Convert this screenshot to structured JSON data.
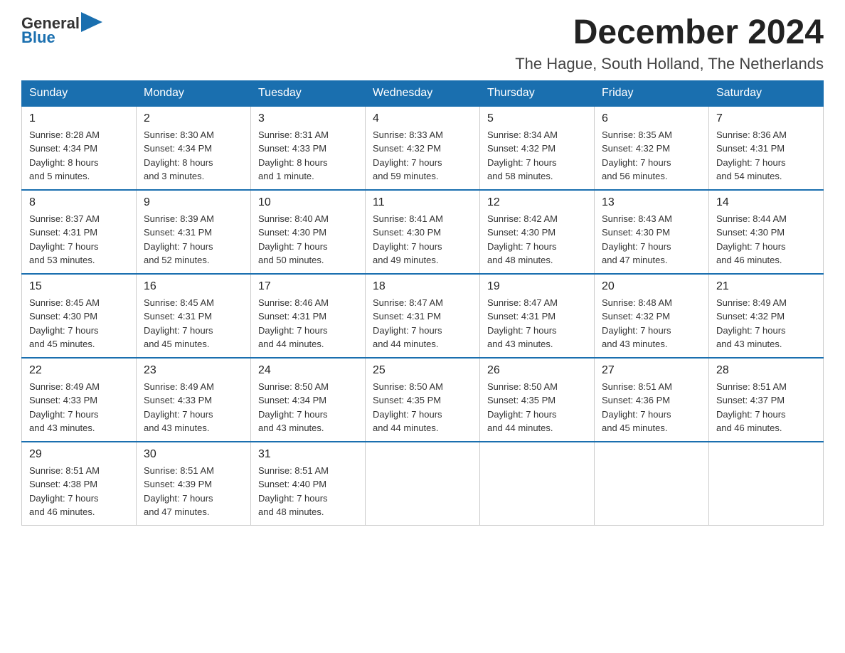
{
  "logo": {
    "text_general": "General",
    "text_blue": "Blue"
  },
  "header": {
    "month_year": "December 2024",
    "location": "The Hague, South Holland, The Netherlands"
  },
  "weekdays": [
    "Sunday",
    "Monday",
    "Tuesday",
    "Wednesday",
    "Thursday",
    "Friday",
    "Saturday"
  ],
  "weeks": [
    [
      {
        "day": "1",
        "sunrise": "8:28 AM",
        "sunset": "4:34 PM",
        "daylight": "8 hours and 5 minutes."
      },
      {
        "day": "2",
        "sunrise": "8:30 AM",
        "sunset": "4:34 PM",
        "daylight": "8 hours and 3 minutes."
      },
      {
        "day": "3",
        "sunrise": "8:31 AM",
        "sunset": "4:33 PM",
        "daylight": "8 hours and 1 minute."
      },
      {
        "day": "4",
        "sunrise": "8:33 AM",
        "sunset": "4:32 PM",
        "daylight": "7 hours and 59 minutes."
      },
      {
        "day": "5",
        "sunrise": "8:34 AM",
        "sunset": "4:32 PM",
        "daylight": "7 hours and 58 minutes."
      },
      {
        "day": "6",
        "sunrise": "8:35 AM",
        "sunset": "4:32 PM",
        "daylight": "7 hours and 56 minutes."
      },
      {
        "day": "7",
        "sunrise": "8:36 AM",
        "sunset": "4:31 PM",
        "daylight": "7 hours and 54 minutes."
      }
    ],
    [
      {
        "day": "8",
        "sunrise": "8:37 AM",
        "sunset": "4:31 PM",
        "daylight": "7 hours and 53 minutes."
      },
      {
        "day": "9",
        "sunrise": "8:39 AM",
        "sunset": "4:31 PM",
        "daylight": "7 hours and 52 minutes."
      },
      {
        "day": "10",
        "sunrise": "8:40 AM",
        "sunset": "4:30 PM",
        "daylight": "7 hours and 50 minutes."
      },
      {
        "day": "11",
        "sunrise": "8:41 AM",
        "sunset": "4:30 PM",
        "daylight": "7 hours and 49 minutes."
      },
      {
        "day": "12",
        "sunrise": "8:42 AM",
        "sunset": "4:30 PM",
        "daylight": "7 hours and 48 minutes."
      },
      {
        "day": "13",
        "sunrise": "8:43 AM",
        "sunset": "4:30 PM",
        "daylight": "7 hours and 47 minutes."
      },
      {
        "day": "14",
        "sunrise": "8:44 AM",
        "sunset": "4:30 PM",
        "daylight": "7 hours and 46 minutes."
      }
    ],
    [
      {
        "day": "15",
        "sunrise": "8:45 AM",
        "sunset": "4:30 PM",
        "daylight": "7 hours and 45 minutes."
      },
      {
        "day": "16",
        "sunrise": "8:45 AM",
        "sunset": "4:31 PM",
        "daylight": "7 hours and 45 minutes."
      },
      {
        "day": "17",
        "sunrise": "8:46 AM",
        "sunset": "4:31 PM",
        "daylight": "7 hours and 44 minutes."
      },
      {
        "day": "18",
        "sunrise": "8:47 AM",
        "sunset": "4:31 PM",
        "daylight": "7 hours and 44 minutes."
      },
      {
        "day": "19",
        "sunrise": "8:47 AM",
        "sunset": "4:31 PM",
        "daylight": "7 hours and 43 minutes."
      },
      {
        "day": "20",
        "sunrise": "8:48 AM",
        "sunset": "4:32 PM",
        "daylight": "7 hours and 43 minutes."
      },
      {
        "day": "21",
        "sunrise": "8:49 AM",
        "sunset": "4:32 PM",
        "daylight": "7 hours and 43 minutes."
      }
    ],
    [
      {
        "day": "22",
        "sunrise": "8:49 AM",
        "sunset": "4:33 PM",
        "daylight": "7 hours and 43 minutes."
      },
      {
        "day": "23",
        "sunrise": "8:49 AM",
        "sunset": "4:33 PM",
        "daylight": "7 hours and 43 minutes."
      },
      {
        "day": "24",
        "sunrise": "8:50 AM",
        "sunset": "4:34 PM",
        "daylight": "7 hours and 43 minutes."
      },
      {
        "day": "25",
        "sunrise": "8:50 AM",
        "sunset": "4:35 PM",
        "daylight": "7 hours and 44 minutes."
      },
      {
        "day": "26",
        "sunrise": "8:50 AM",
        "sunset": "4:35 PM",
        "daylight": "7 hours and 44 minutes."
      },
      {
        "day": "27",
        "sunrise": "8:51 AM",
        "sunset": "4:36 PM",
        "daylight": "7 hours and 45 minutes."
      },
      {
        "day": "28",
        "sunrise": "8:51 AM",
        "sunset": "4:37 PM",
        "daylight": "7 hours and 46 minutes."
      }
    ],
    [
      {
        "day": "29",
        "sunrise": "8:51 AM",
        "sunset": "4:38 PM",
        "daylight": "7 hours and 46 minutes."
      },
      {
        "day": "30",
        "sunrise": "8:51 AM",
        "sunset": "4:39 PM",
        "daylight": "7 hours and 47 minutes."
      },
      {
        "day": "31",
        "sunrise": "8:51 AM",
        "sunset": "4:40 PM",
        "daylight": "7 hours and 48 minutes."
      },
      null,
      null,
      null,
      null
    ]
  ]
}
